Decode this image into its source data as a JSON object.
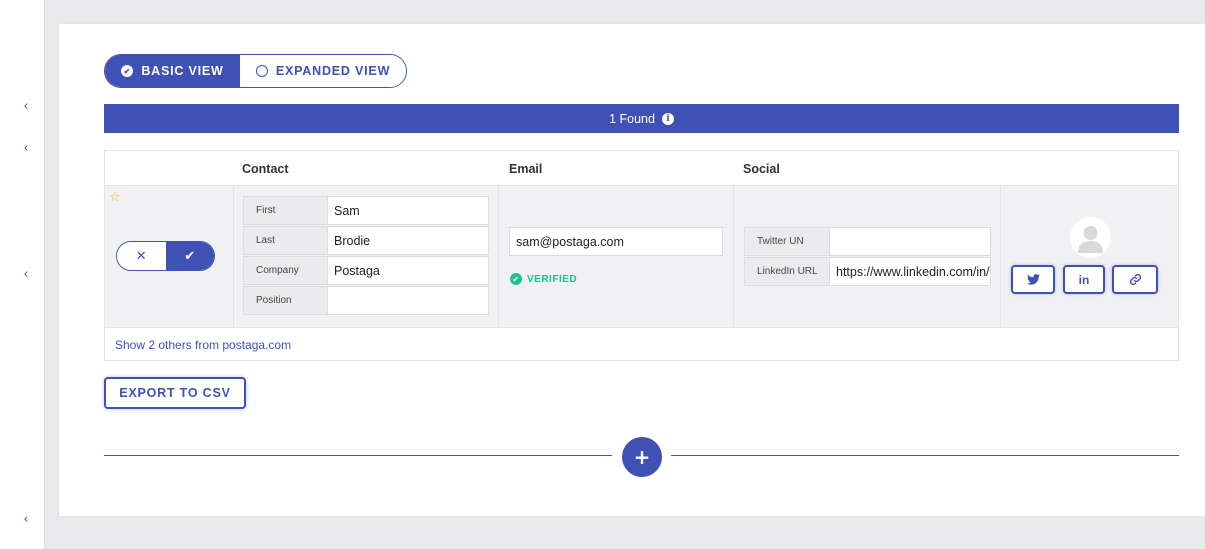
{
  "sidebar": {
    "chevrons": [
      "‹",
      "‹",
      "‹",
      "‹"
    ]
  },
  "view_toggle": {
    "basic_label": "BASIC VIEW",
    "expanded_label": "EXPANDED VIEW",
    "selected": "basic"
  },
  "found_bar": {
    "text": "1 Found",
    "info_icon": "i"
  },
  "table": {
    "headers": {
      "contact": "Contact",
      "email": "Email",
      "social": "Social"
    },
    "row": {
      "starred": false,
      "contact_fields": [
        {
          "label": "First",
          "value": "Sam"
        },
        {
          "label": "Last",
          "value": "Brodie"
        },
        {
          "label": "Company",
          "value": "Postaga"
        },
        {
          "label": "Position",
          "value": ""
        }
      ],
      "email": "sam@postaga.com",
      "email_status": "VERIFIED",
      "social_fields": [
        {
          "label": "Twitter UN",
          "value": ""
        },
        {
          "label": "LinkedIn URL",
          "value": "https://www.linkedin.com/in/s"
        }
      ],
      "social_buttons": [
        "twitter-icon",
        "linkedin-icon",
        "link-icon"
      ],
      "linkedin_text": "in"
    },
    "footer_link": "Show 2 others from postaga.com"
  },
  "export_label": "EXPORT TO CSV",
  "add_icon": "+",
  "colors": {
    "accent": "#3f51b5",
    "verified": "#1fbf8f",
    "star": "#f2b01e"
  }
}
